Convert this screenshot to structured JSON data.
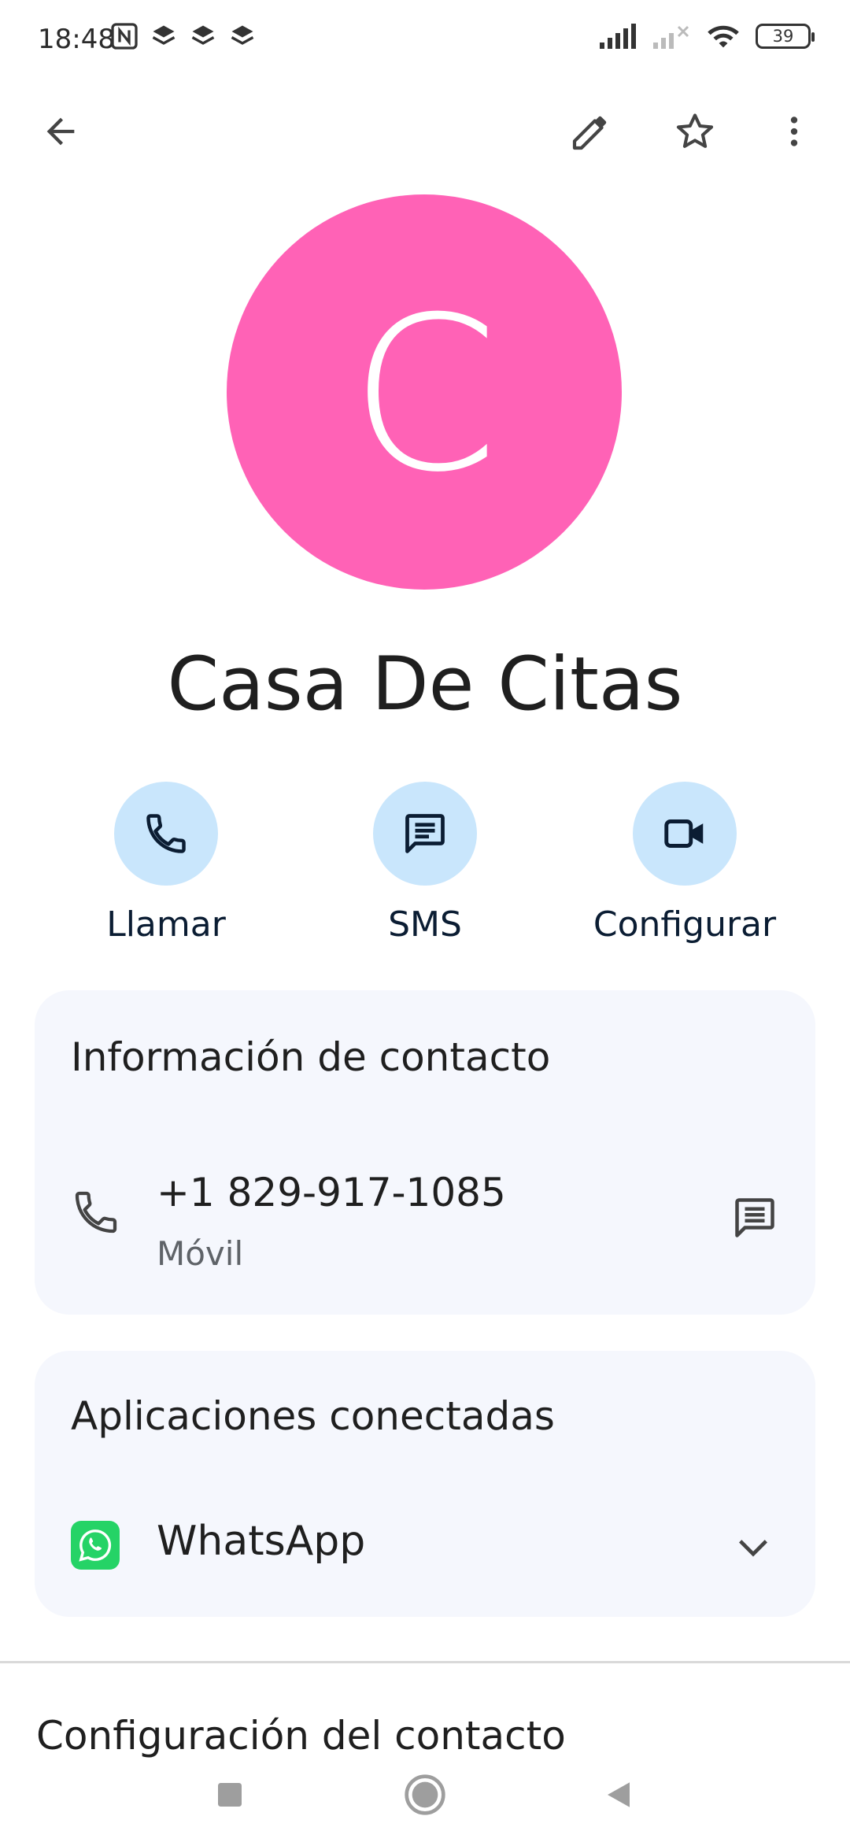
{
  "status_bar": {
    "time": "18:48",
    "battery": "39"
  },
  "header": {
    "back_icon": "arrow-left-icon",
    "edit_icon": "pencil-icon",
    "star_icon": "star-outline-icon",
    "more_icon": "more-vert-icon"
  },
  "contact": {
    "initial": "C",
    "name": "Casa De Citas",
    "avatar_color": "#ff62b6"
  },
  "actions": [
    {
      "label": "Llamar",
      "icon": "phone-icon"
    },
    {
      "label": "SMS",
      "icon": "message-icon"
    },
    {
      "label": "Configurar",
      "icon": "video-camera-icon"
    }
  ],
  "contact_info": {
    "title": "Información de contacto",
    "phone": "+1 829-917-1085",
    "phone_type": "Móvil"
  },
  "connected_apps": {
    "title": "Aplicaciones conectadas",
    "app": "WhatsApp"
  },
  "settings": {
    "title": "Configuración del contacto"
  },
  "colors": {
    "action_circle": "#c9e6fc",
    "card_bg": "#f5f7fd",
    "icon_dark": "#0b1d33",
    "whatsapp_green": "#25d366"
  }
}
